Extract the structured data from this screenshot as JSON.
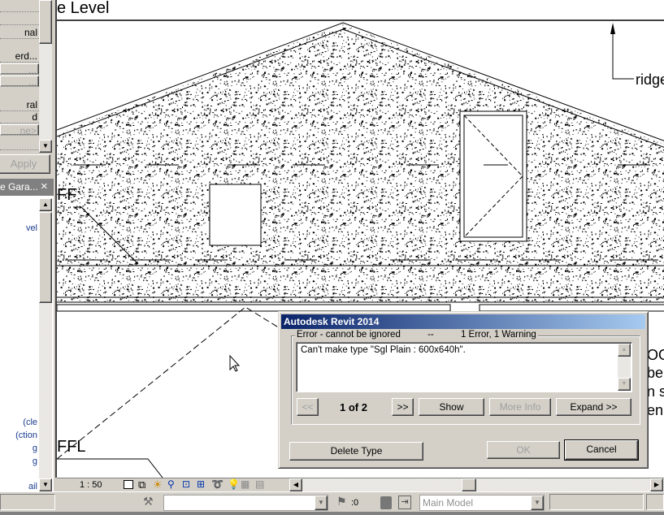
{
  "properties": {
    "rows": [
      "",
      "nal",
      "erd...",
      "...",
      "...",
      "ral",
      "d",
      "ne>",
      ""
    ],
    "apply_label": "Apply"
  },
  "browser": {
    "title": "e Gara...",
    "close": "×",
    "items": [
      "vel",
      "cle)",
      "ction)",
      "g",
      "g",
      "ail"
    ]
  },
  "drawing": {
    "level_label": "e Level",
    "ridge_label": "ridge",
    "ff_label": "FF",
    "ffl_label": "FFL",
    "right_fragments": [
      "OO",
      "be",
      "n s",
      "eni"
    ]
  },
  "view_bar": {
    "scale": "1 : 50"
  },
  "status_bar": {
    "selection_count": ":0",
    "model": "Main Model"
  },
  "dialog": {
    "title": "Autodesk Revit 2014",
    "group_label": "Error - cannot be ignored",
    "separator": "--",
    "summary": "1 Error, 1 Warning",
    "message": "Can't make type \"Sgl Plain : 600x640h\".",
    "prev_label": "<<",
    "pager": "1 of 2",
    "next_label": ">>",
    "show_label": "Show",
    "more_info_label": "More Info",
    "expand_label": "Expand >>",
    "delete_type_label": "Delete Type",
    "ok_label": "OK",
    "cancel_label": "Cancel"
  },
  "colors": {
    "titlebar_start": "#0a246a",
    "titlebar_end": "#a6caf0",
    "tree_text": "#1a3b8f"
  }
}
